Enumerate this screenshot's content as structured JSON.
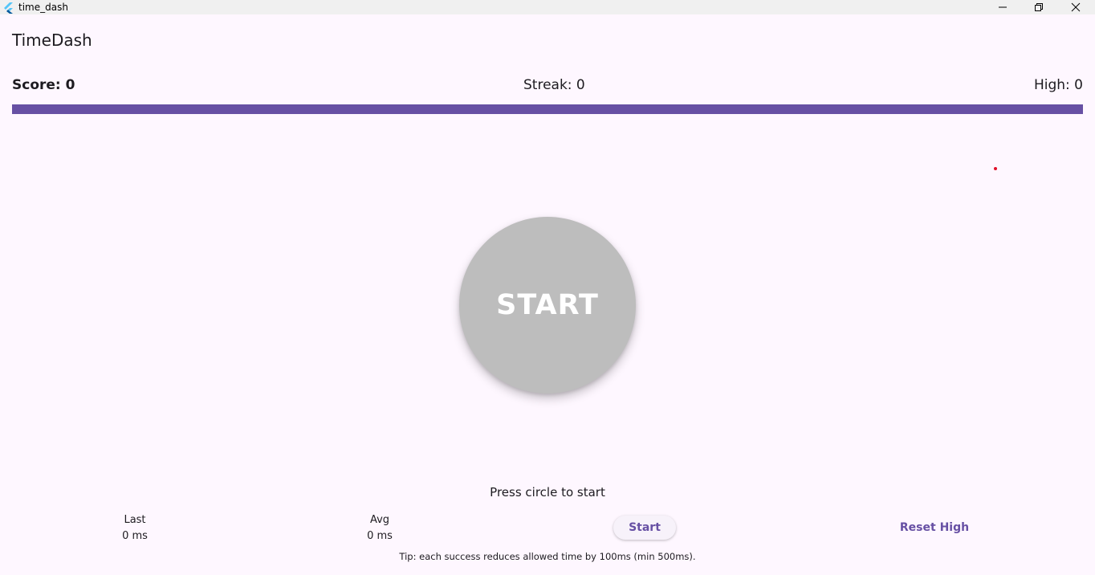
{
  "window": {
    "title": "time_dash",
    "icon": "flutter-logo",
    "controls": [
      "minimize-icon",
      "maximize-icon",
      "close-icon"
    ]
  },
  "app": {
    "title": "TimeDash"
  },
  "scoreboard": {
    "score": "Score: 0",
    "streak": "Streak: 0",
    "high": "High: 0"
  },
  "timer": {
    "progress_fraction": 1.0,
    "color": "#6750A4"
  },
  "target_dot": {
    "color": "#E0102A"
  },
  "circle": {
    "label": "START",
    "color": "#BDBDBD"
  },
  "status": "Press circle to start",
  "stats": {
    "last_label": "Last",
    "last_value": "0 ms",
    "avg_label": "Avg",
    "avg_value": "0 ms"
  },
  "buttons": {
    "start": "Start",
    "reset_high": "Reset High"
  },
  "tip": "Tip: each success reduces allowed time by 100ms (min 500ms).",
  "colors": {
    "background": "#FEF7FF",
    "accent": "#6750A4"
  }
}
